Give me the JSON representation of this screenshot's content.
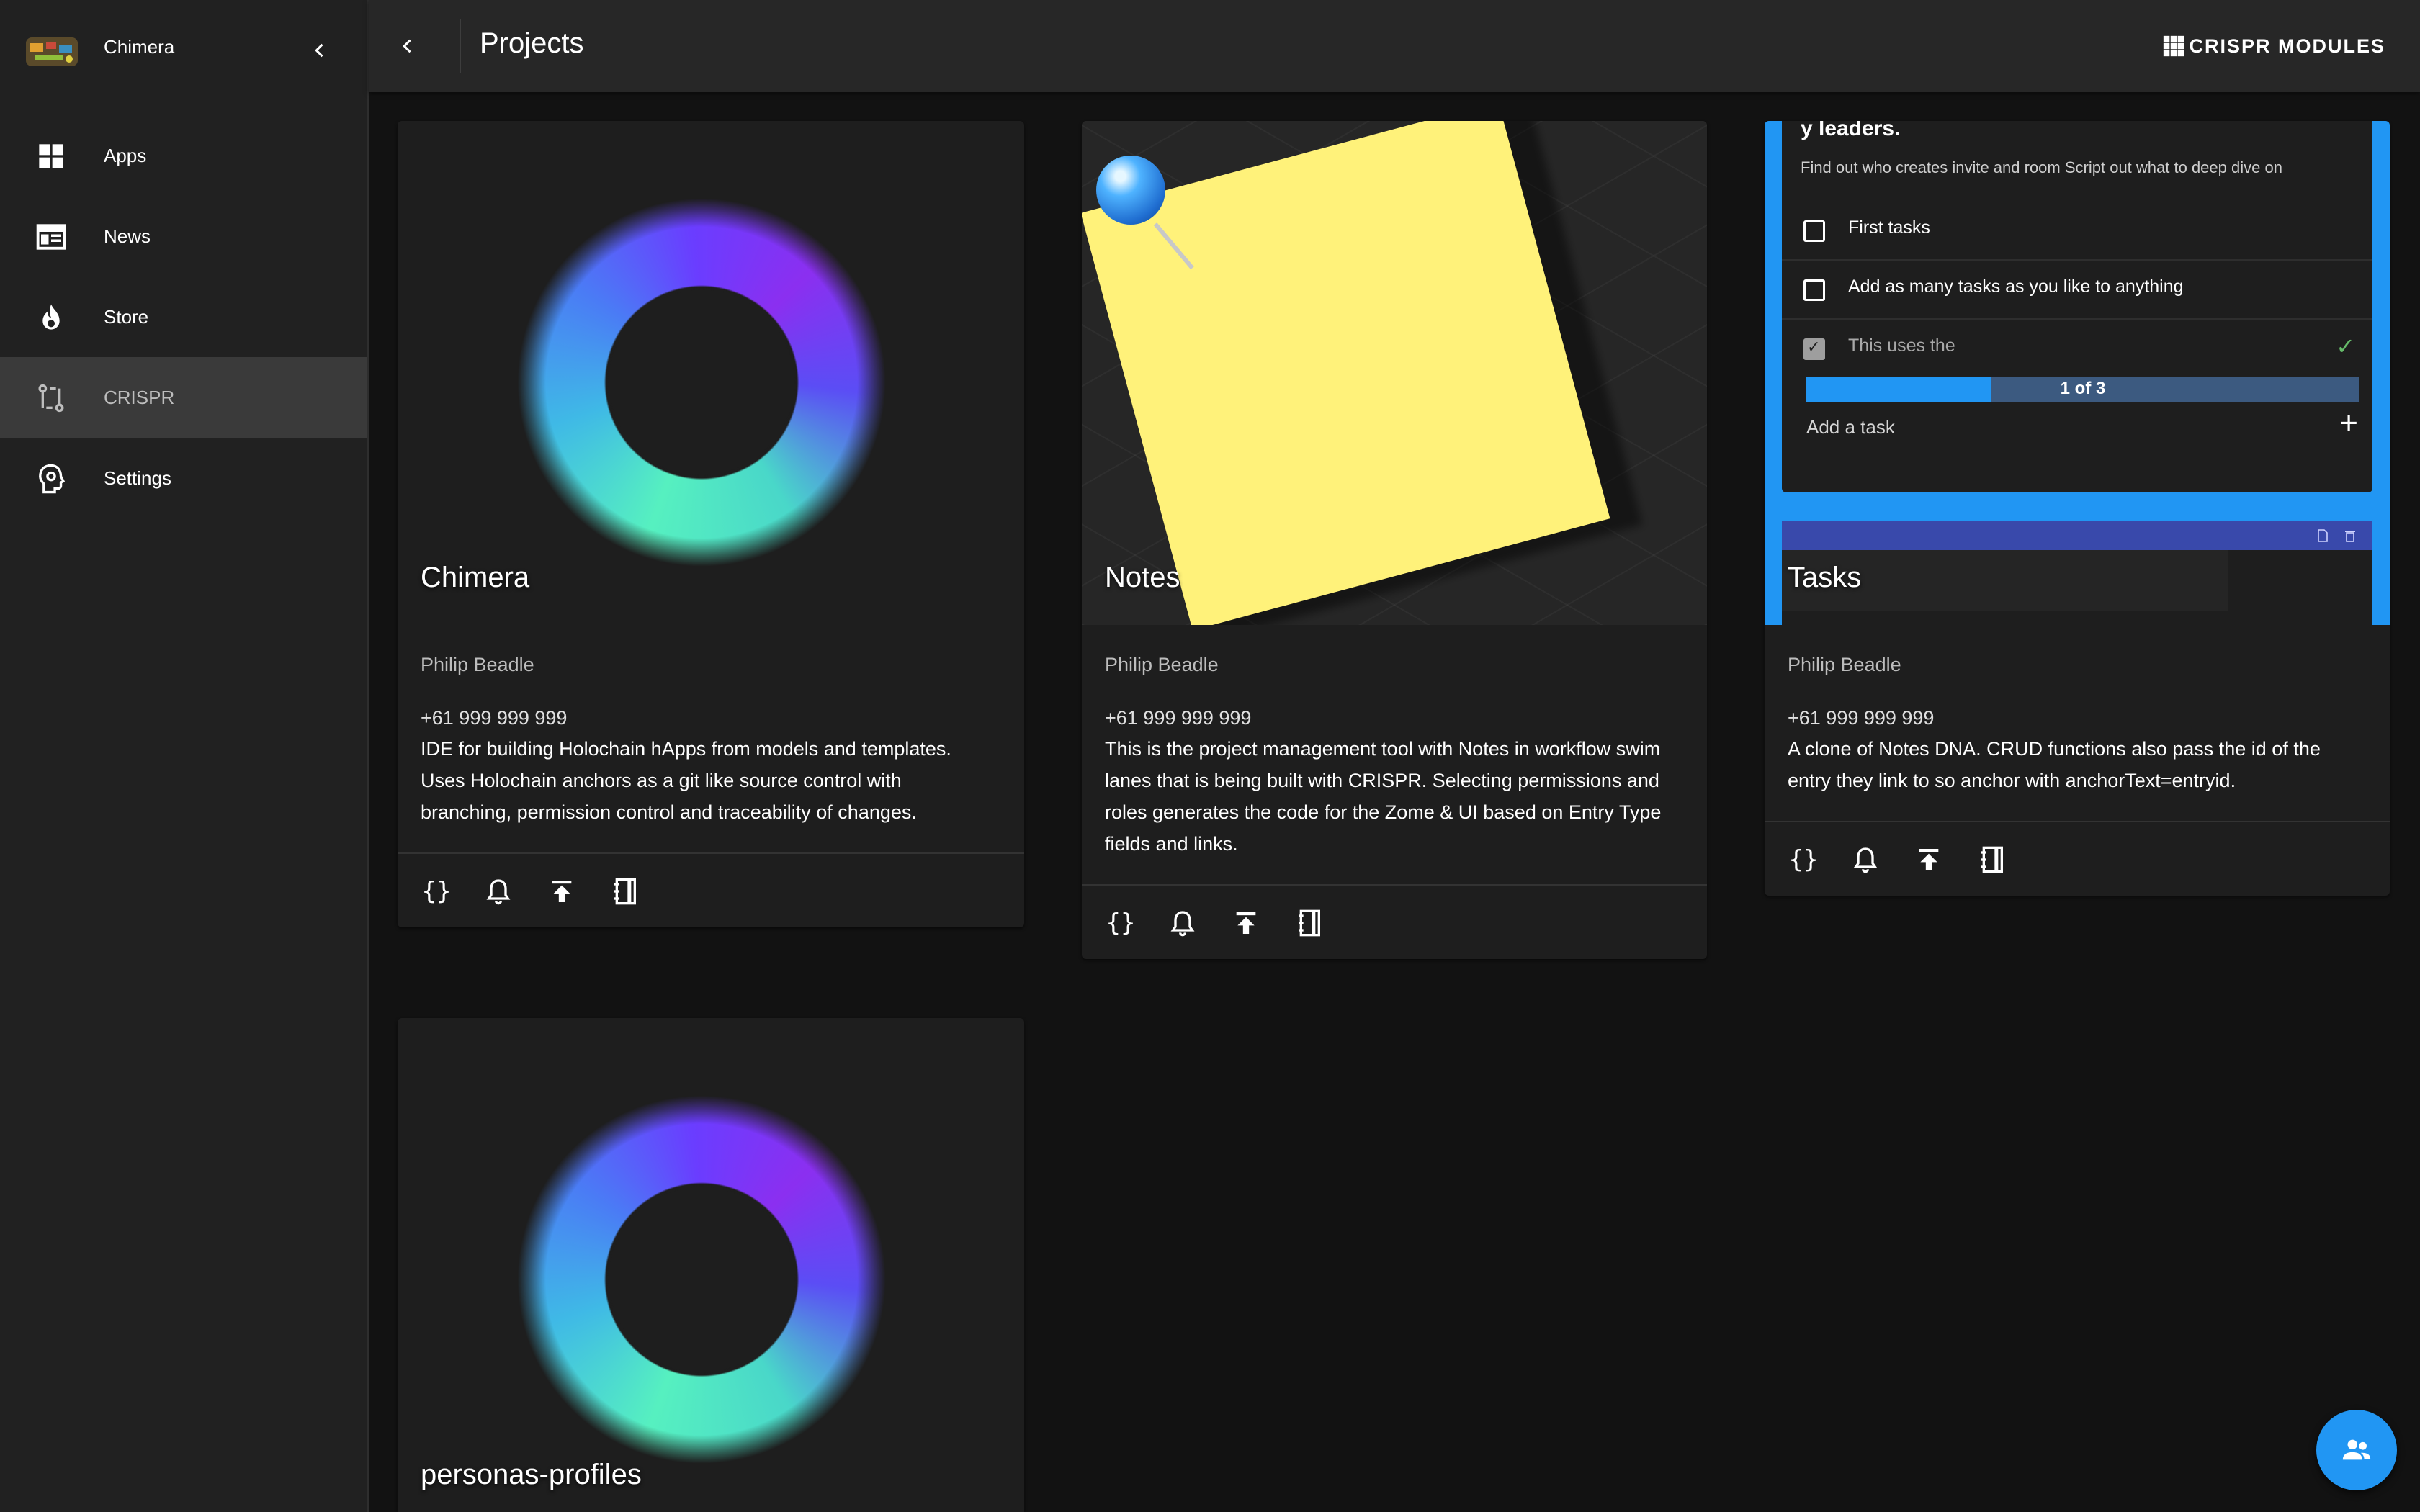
{
  "app": {
    "name": "Chimera",
    "logo_icon": "app-logo-icon"
  },
  "sidebar": {
    "items": [
      {
        "label": "Apps",
        "icon": "grid-icon"
      },
      {
        "label": "News",
        "icon": "news-icon"
      },
      {
        "label": "Store",
        "icon": "fire-icon"
      },
      {
        "label": "CRISPR",
        "icon": "git-compare-icon",
        "active": true
      },
      {
        "label": "Settings",
        "icon": "head-settings-icon"
      }
    ]
  },
  "header": {
    "title": "Projects",
    "modules_label": "CRISPR MODULES"
  },
  "cards": [
    {
      "title": "Chimera",
      "owner": "Philip Beadle",
      "phone": "+61 999 999 999",
      "description": "IDE for building Holochain hApps from models and templates. Uses Holochain anchors as a git like source control with branching, permission control and traceability of changes."
    },
    {
      "title": "Notes",
      "owner": "Philip Beadle",
      "phone": "+61 999 999 999",
      "description": "This is the project management tool with Notes in workflow swim lanes that is being built with CRISPR. Selecting permissions and roles generates the code for the Zome & UI based on Entry Type fields and links."
    },
    {
      "title": "Tasks",
      "owner": "Philip Beadle",
      "phone": "+61 999 999 999",
      "description": "A clone of Notes DNA. CRUD functions also pass the id of the entry they link to so anchor with anchorText=entryid."
    },
    {
      "title": "personas-profiles"
    }
  ],
  "tasks_preview": {
    "heading_fragment": "y leaders.",
    "subtitle": "Find out who creates invite and room Script out what to deep dive on",
    "items": [
      {
        "label": "First tasks",
        "done": false
      },
      {
        "label": "Add as many tasks as you like to anything",
        "done": false
      },
      {
        "label": "This uses the",
        "done": true
      }
    ],
    "progress_label": "1 of 3",
    "progress_fraction": 0.333,
    "add_placeholder": "Add a task",
    "add_icon": "+"
  },
  "colors": {
    "accent": "#2196f3",
    "sidebar_bg": "#212121",
    "page_bg": "#121212",
    "card_bg": "#1e1e1e",
    "indigo_bar": "#3949ab",
    "sticky_note": "#fff27a"
  }
}
